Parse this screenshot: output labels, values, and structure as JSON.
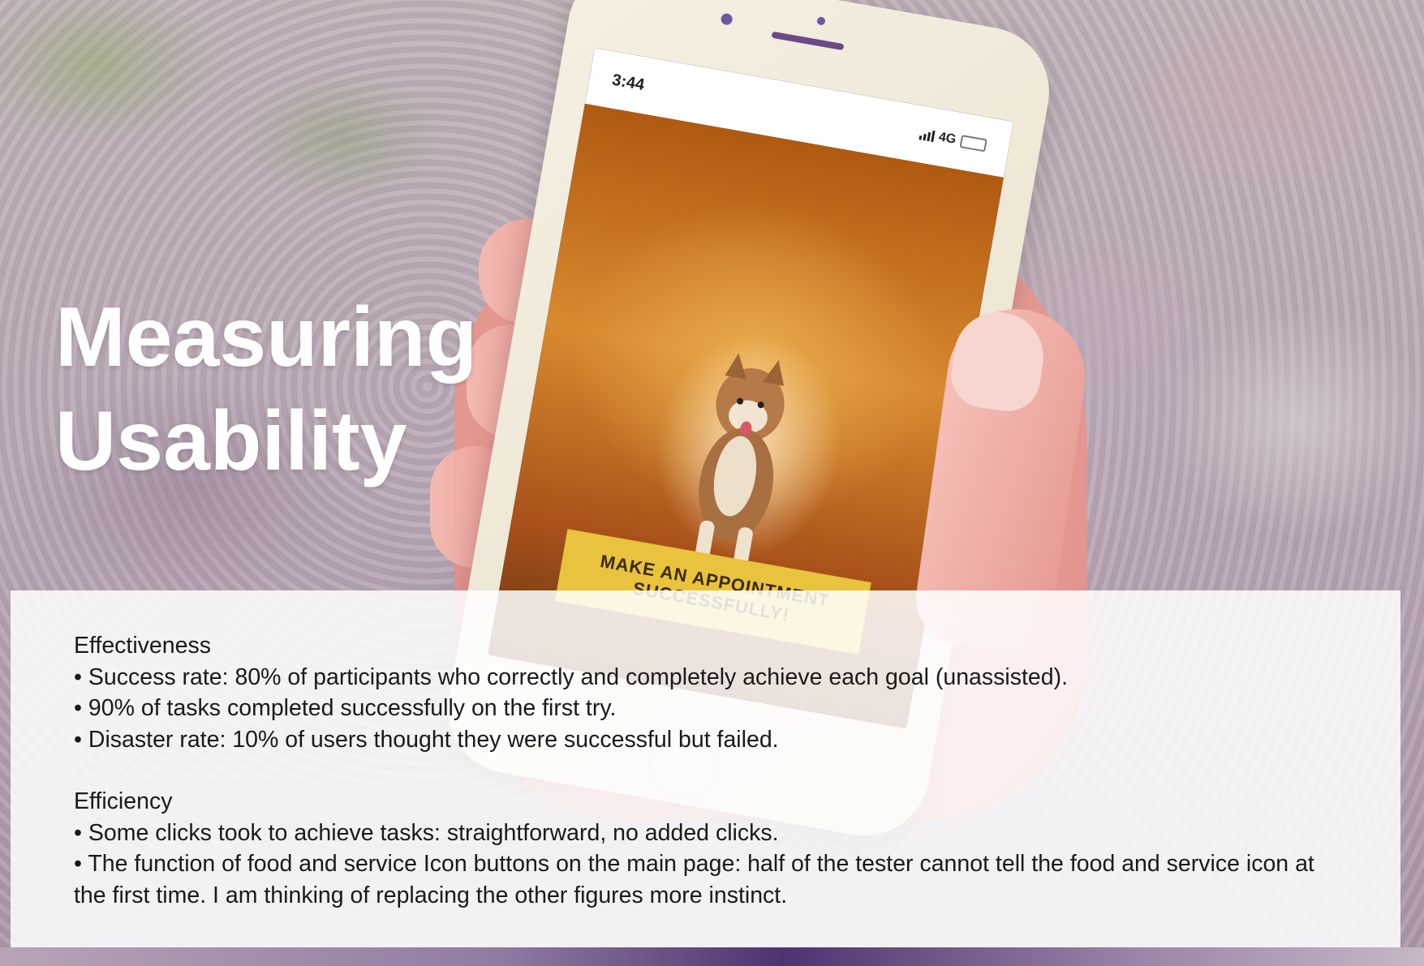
{
  "slide": {
    "title_line1": "Measuring",
    "title_line2": "Usability"
  },
  "phone": {
    "time": "3:44",
    "network": "4G",
    "cta_line1": "MAKE AN APPOINTMENT",
    "cta_line2": "SUCCESSFULLY!"
  },
  "effectiveness": {
    "heading": "Effectiveness",
    "items": [
      "• Success rate: 80% of participants who correctly and completely achieve each goal (unassisted).",
      "• 90% of tasks completed successfully on the first try.",
      "• Disaster rate: 10% of users thought they were successful but failed."
    ]
  },
  "efficiency": {
    "heading": "Efficiency",
    "items": [
      "• Some clicks took to achieve tasks: straightforward, no added clicks.",
      "• The function of food and service Icon buttons on the main page: half of the tester cannot tell the food and service icon at the first time. I am thinking of replacing the other figures more instinct."
    ]
  },
  "colors": {
    "title": "#ffffff",
    "panel": "#ffffff",
    "cta": "#e9c23e"
  }
}
